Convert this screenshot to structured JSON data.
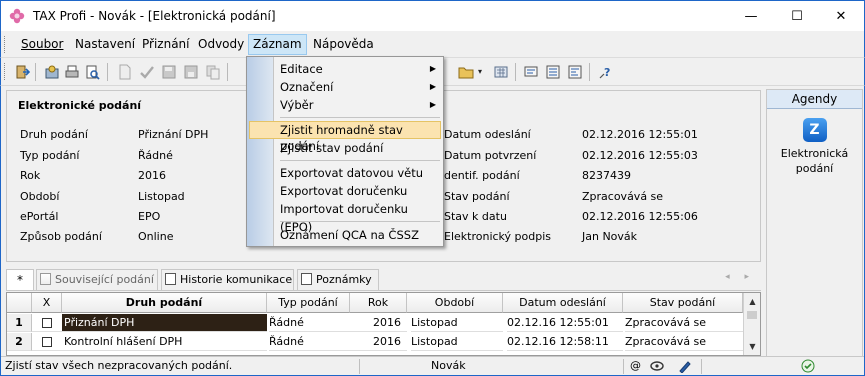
{
  "window": {
    "title": "TAX Profi - Novák - [Elektronická podání]",
    "controls": [
      "—",
      "☐",
      "✕"
    ]
  },
  "menubar": {
    "items": [
      {
        "label": "Soubor"
      },
      {
        "label": "Nastavení"
      },
      {
        "label": "Přiznání"
      },
      {
        "label": "Odvody"
      },
      {
        "label": "Záznam"
      },
      {
        "label": "Nápověda"
      }
    ]
  },
  "dropdown": {
    "items": [
      {
        "label": "Editace",
        "submenu": true
      },
      {
        "label": "Označení",
        "submenu": true
      },
      {
        "label": "Výběr",
        "submenu": true
      },
      {
        "label": "Zjistit hromadně stav podání",
        "highlighted": true
      },
      {
        "label": "Zjistit stav podání"
      },
      {
        "label": "Exportovat datovou větu"
      },
      {
        "label": "Exportovat doručenku"
      },
      {
        "label": "Importovat doručenku (EPO)"
      },
      {
        "label": "Oznámení QCA na ČSSZ"
      }
    ],
    "submenu_arrow": "▶"
  },
  "panel": {
    "title": "Elektronické podání",
    "left_fields": [
      {
        "label": "Druh podání",
        "value": "Přiznání DPH"
      },
      {
        "label": "Typ podání",
        "value": "Řádné"
      },
      {
        "label": "Rok",
        "value": "2016"
      },
      {
        "label": "Období",
        "value": "Listopad"
      },
      {
        "label": "ePortál",
        "value": "EPO"
      },
      {
        "label": "Způsob podání",
        "value": "Online"
      }
    ],
    "right_fields": [
      {
        "label": "Datum odeslání",
        "value": "02.12.2016 12:55:01"
      },
      {
        "label": "Datum potvrzení",
        "value": "02.12.2016 12:55:03"
      },
      {
        "label": "dentif. podání",
        "value": "8237439"
      },
      {
        "label": "Stav podání",
        "value": "Zpracovává se"
      },
      {
        "label": "Stav k datu",
        "value": "02.12.2016 12:55:06"
      },
      {
        "label": "Elektronický podpis",
        "value": "Jan Novák"
      }
    ]
  },
  "agendy": {
    "title": "Agendy",
    "item_label": "Elektronická podání",
    "icon_glyph": "Z"
  },
  "tabs": {
    "star": "*",
    "items": [
      {
        "label": "Související podání"
      },
      {
        "label": "Historie komunikace"
      },
      {
        "label": "Poznámky"
      }
    ],
    "nav": "◂ ▸"
  },
  "grid": {
    "columns": [
      "",
      "X",
      "Druh podání",
      "Typ podání",
      "Rok",
      "Období",
      "Datum odeslání",
      "Stav podání"
    ],
    "rows": [
      {
        "index": "1",
        "druh": "Přiznání DPH",
        "typ": "Řádné",
        "rok": "2016",
        "obdobi": "Listopad",
        "datum": "02.12.16 12:55:01",
        "stav": "Zpracovává se",
        "selected": true
      },
      {
        "index": "2",
        "druh": "Kontrolní hlášení DPH",
        "typ": "Řádné",
        "rok": "2016",
        "obdobi": "Listopad",
        "datum": "02.12.16 12:58:11",
        "stav": "Zpracovává se",
        "selected": false
      }
    ],
    "scroll_up": "▲",
    "scroll_down": "▼"
  },
  "statusbar": {
    "message": "Zjistí stav všech nezpracovaných podání.",
    "user": "Novák",
    "at_symbol": "@"
  },
  "colors": {
    "accent": "#1e66c8",
    "menu_highlight": "#fbe3b0",
    "selected_row": "#2d2115"
  }
}
